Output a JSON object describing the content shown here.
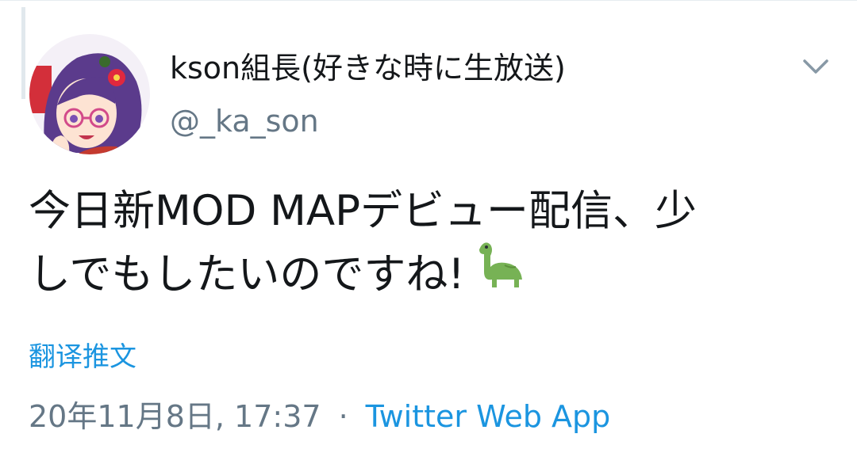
{
  "tweet": {
    "author": {
      "display_name": "kson組長(好きな時に生放送)",
      "handle": "@_ka_son",
      "avatar_icon": "avatar-icon"
    },
    "text_line1": "今日新MOD MAPデビュー配信、少",
    "text_line2": "しでもしたいのですね!",
    "emoji": "sauropod-dinosaur-icon",
    "translate_label": "翻译推文",
    "timestamp": "20年11月8日, 17:37",
    "separator": "·",
    "source": "Twitter Web App",
    "menu_icon": "chevron-down-icon"
  },
  "colors": {
    "text": "#14171a",
    "secondary": "#657786",
    "link": "#1b95e0",
    "emoji_green": "#77b255"
  }
}
